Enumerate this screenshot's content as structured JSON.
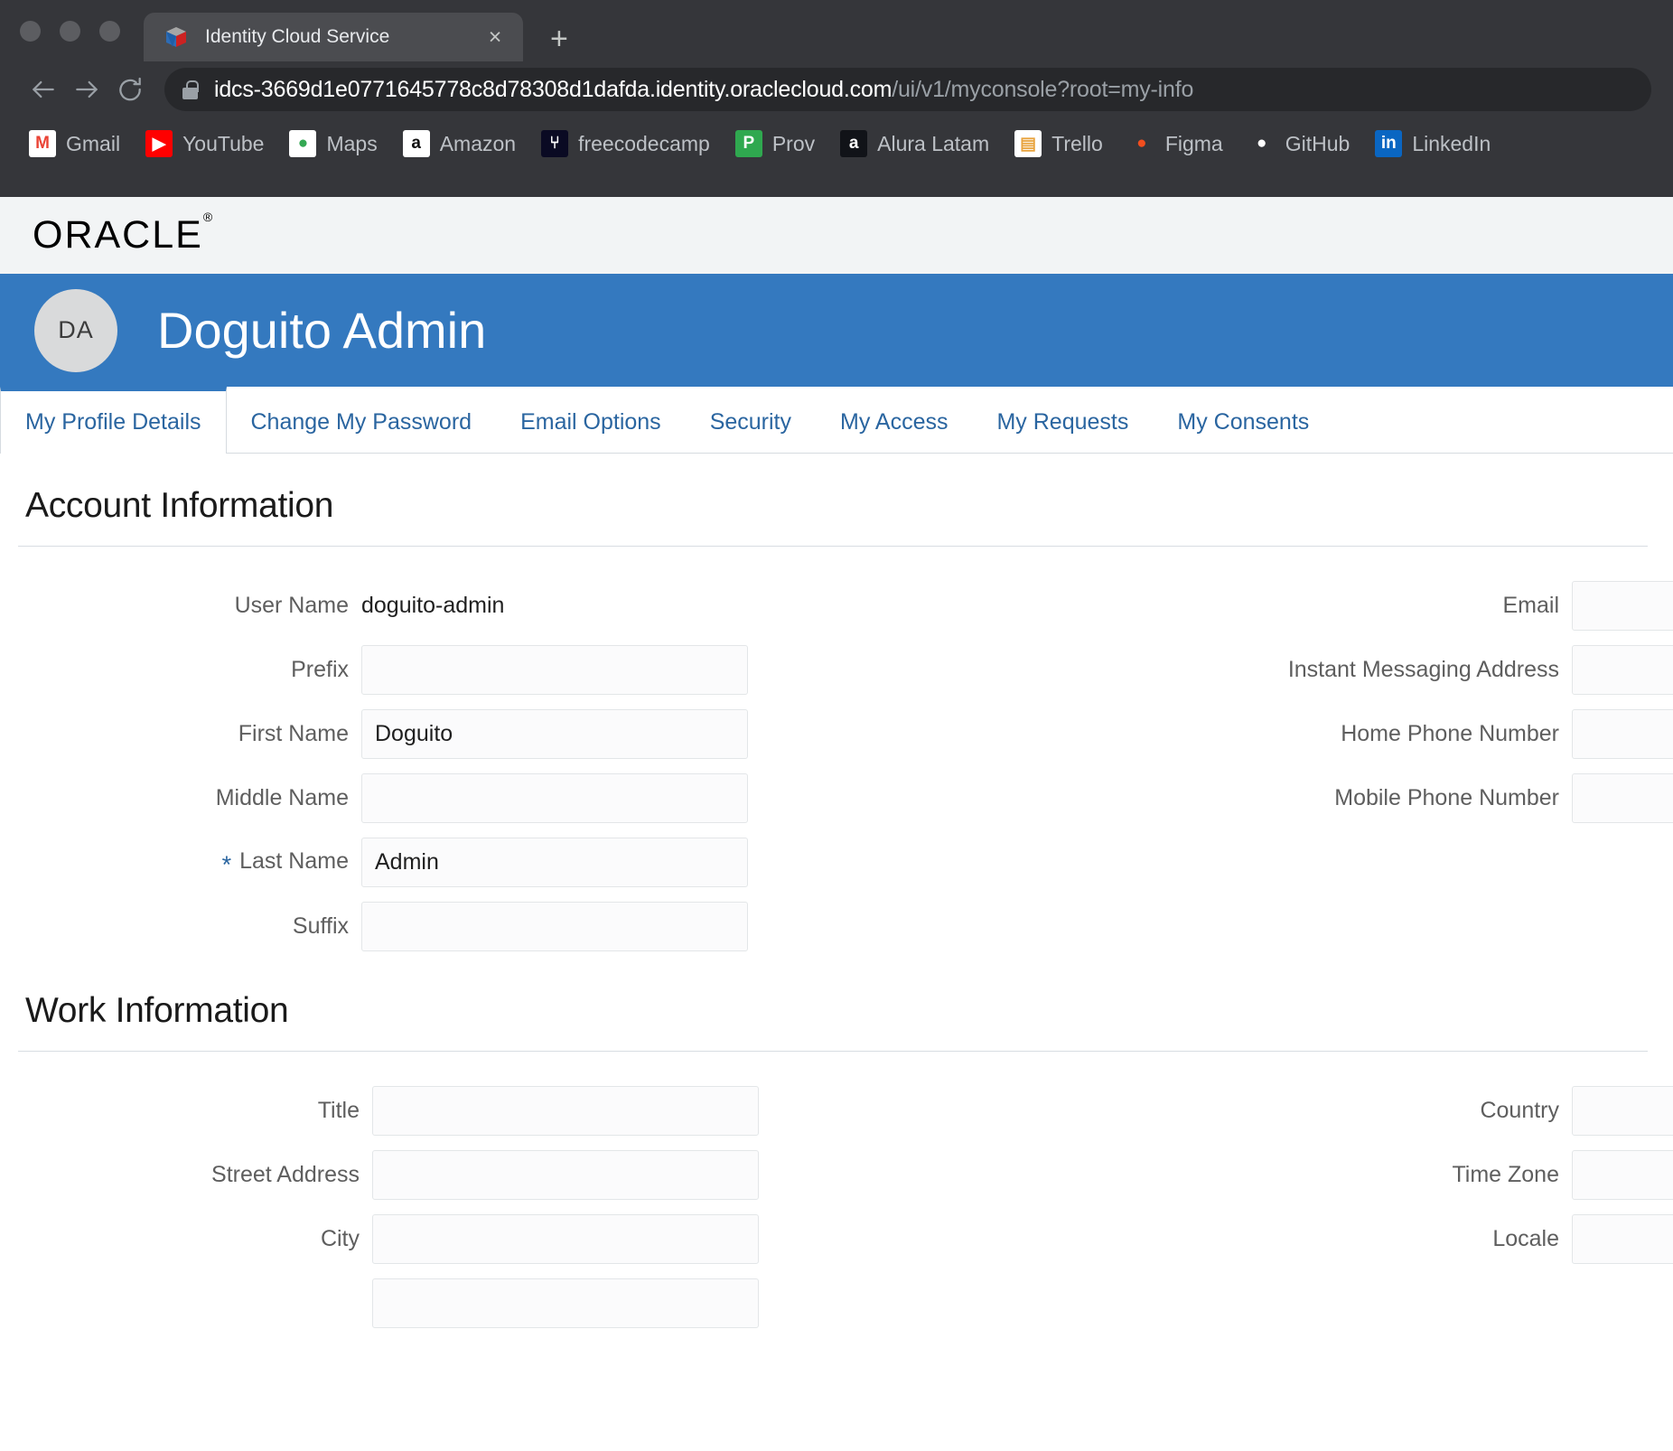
{
  "browser": {
    "window_controls": [
      "close",
      "minimize",
      "maximize"
    ],
    "tab": {
      "title": "Identity Cloud Service",
      "favicon": "oracle-idcs-icon",
      "close_label": "×"
    },
    "new_tab_label": "+",
    "nav": {
      "back_label": "back-arrow",
      "forward_label": "forward-arrow",
      "reload_label": "reload"
    },
    "omnibox": {
      "lock_icon": "lock-icon",
      "url_host": "idcs-3669d1e0771645778c8d78308d1dafda.identity.oraclecloud.com",
      "url_path": "/ui/v1/myconsole?root=my-info"
    },
    "bookmarks": [
      {
        "label": "Gmail",
        "icon": "gmail-icon",
        "glyph": "M",
        "bg": "#ffffff",
        "fg": "#ea4335"
      },
      {
        "label": "YouTube",
        "icon": "youtube-icon",
        "glyph": "▶",
        "bg": "#ff0000",
        "fg": "#ffffff"
      },
      {
        "label": "Maps",
        "icon": "google-maps-icon",
        "glyph": "●",
        "bg": "#ffffff",
        "fg": "#34a853"
      },
      {
        "label": "Amazon",
        "icon": "amazon-icon",
        "glyph": "a",
        "bg": "#ffffff",
        "fg": "#111111"
      },
      {
        "label": "freecodecamp",
        "icon": "freecodecamp-icon",
        "glyph": "⑂",
        "bg": "#0a0a23",
        "fg": "#ffffff"
      },
      {
        "label": "Prov",
        "icon": "prov-icon",
        "glyph": "P",
        "bg": "#2fa84f",
        "fg": "#ffffff"
      },
      {
        "label": "Alura Latam",
        "icon": "alura-icon",
        "glyph": "a",
        "bg": "#111318",
        "fg": "#ffffff"
      },
      {
        "label": "Trello",
        "icon": "trello-icon",
        "glyph": "▤",
        "bg": "#ffffff",
        "fg": "#e8a33d"
      },
      {
        "label": "Figma",
        "icon": "figma-icon",
        "glyph": "●",
        "bg": "#35363a",
        "fg": "#f24e1e"
      },
      {
        "label": "GitHub",
        "icon": "github-icon",
        "glyph": "●",
        "bg": "#35363a",
        "fg": "#ffffff"
      },
      {
        "label": "LinkedIn",
        "icon": "linkedin-icon",
        "glyph": "in",
        "bg": "#0a66c2",
        "fg": "#ffffff"
      }
    ]
  },
  "app": {
    "brand": "ORACLE",
    "brand_mark": "®",
    "banner": {
      "avatar_initials": "DA",
      "display_name": "Doguito Admin",
      "banner_color": "#3479bf"
    },
    "tabs": [
      {
        "label": "My Profile Details",
        "active": true
      },
      {
        "label": "Change My Password",
        "active": false
      },
      {
        "label": "Email Options",
        "active": false
      },
      {
        "label": "Security",
        "active": false
      },
      {
        "label": "My Access",
        "active": false
      },
      {
        "label": "My Requests",
        "active": false
      },
      {
        "label": "My Consents",
        "active": false
      }
    ],
    "accent_color": "#2a65a0"
  },
  "account_information": {
    "title": "Account Information",
    "left": [
      {
        "label": "User Name",
        "type": "static",
        "value": "doguito-admin",
        "required": false
      },
      {
        "label": "Prefix",
        "type": "input",
        "value": "",
        "required": false
      },
      {
        "label": "First Name",
        "type": "input",
        "value": "Doguito",
        "required": false
      },
      {
        "label": "Middle Name",
        "type": "input",
        "value": "",
        "required": false
      },
      {
        "label": "Last Name",
        "type": "input",
        "value": "Admin",
        "required": true
      },
      {
        "label": "Suffix",
        "type": "input",
        "value": "",
        "required": false
      }
    ],
    "right": [
      {
        "label": "Email",
        "type": "input",
        "value": "",
        "required": false
      },
      {
        "label": "Instant Messaging Address",
        "type": "input",
        "value": "",
        "required": false
      },
      {
        "label": "Home Phone Number",
        "type": "input",
        "value": "",
        "required": false
      },
      {
        "label": "Mobile Phone Number",
        "type": "input",
        "value": "",
        "required": false
      }
    ]
  },
  "work_information": {
    "title": "Work Information",
    "left": [
      {
        "label": "Title",
        "type": "input",
        "value": "",
        "required": false
      },
      {
        "label": "Street Address",
        "type": "input",
        "value": "",
        "required": false
      },
      {
        "label": "City",
        "type": "input",
        "value": "",
        "required": false
      },
      {
        "label": "",
        "type": "input",
        "value": "",
        "required": false
      }
    ],
    "right": [
      {
        "label": "Country",
        "type": "input",
        "value": "",
        "required": false
      },
      {
        "label": "Time Zone",
        "type": "input",
        "value": "",
        "required": false
      },
      {
        "label": "Locale",
        "type": "input",
        "value": "",
        "required": false
      }
    ]
  },
  "required_marker": "*"
}
